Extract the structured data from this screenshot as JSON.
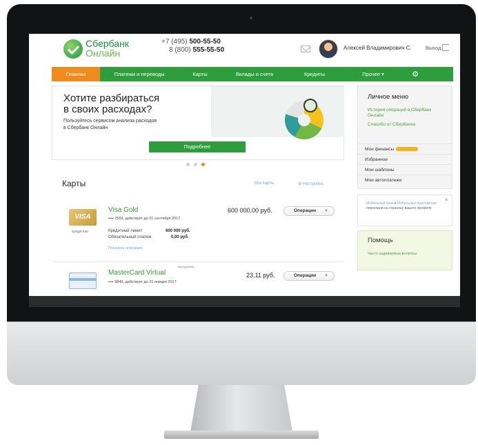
{
  "header": {
    "logo_line1": "Сбербанк",
    "logo_line2": "Онлайн",
    "phone1_prefix": "+7 (495) ",
    "phone1_number": "500-55-50",
    "phone2_prefix": "8 (800) ",
    "phone2_number": "555-55-50",
    "user_name": "Алексей Владимирович С.",
    "logout_label": "Выход"
  },
  "nav": {
    "items": [
      "Главная",
      "Платежи и переводы",
      "Карты",
      "Вклады и счета",
      "Кредиты",
      "Прочее ▾"
    ],
    "active_index": 0
  },
  "banner": {
    "title_line1": "Хотите разбираться",
    "title_line2": "в своих расходах?",
    "subtitle_line1": "Пользуйтесь сервисом анализа расходов",
    "subtitle_line2": "в Сбербанк Онлайн",
    "button_label": "Подробнее",
    "slide_count": 3,
    "active_slide": 2
  },
  "cards_section": {
    "title": "Карты",
    "all_cards_link": "Все карты",
    "settings_link": "Настройка",
    "cards": [
      {
        "name": "Visa Gold",
        "number_line": "•••• 7559, действует до 01 сентября 2017",
        "amount": "600 000,00 руб.",
        "ops_label": "Операции",
        "card_logo": "VISA",
        "type_label": "кредитная",
        "limit_label": "Кредитный лимит",
        "limit_value": "600 000 руб.",
        "payment_label": "Обязательный платеж",
        "payment_value": "0,00 руб.",
        "show_ops_link": "Показать операции"
      },
      {
        "name": "MasterCard Virtual",
        "tag": "виртуальная",
        "number_line": "•••• 9849, действует до 31 января 2017",
        "amount": "23,11 руб.",
        "ops_label": "Операции"
      }
    ]
  },
  "sidebar": {
    "title": "Личное меню",
    "links": [
      "История операций в Сбербанк Онлайн",
      "Спасибо от Сбербанка"
    ],
    "items": [
      "Мои финансы",
      "Избранное",
      "Мои шаблоны",
      "Мои автоплатежи"
    ],
    "notice_part1": "Мобильный банк",
    "notice_and": " и ",
    "notice_part2": "Мобильные приложения",
    "notice_rest": " переехали на страницу вашего профиля",
    "help_title": "Помощь",
    "help_link": "Часто задаваемые вопросы"
  },
  "colors": {
    "brand_green": "#2d9e3b",
    "active_orange": "#f08a1a",
    "link_blue": "#7aa9d6"
  }
}
